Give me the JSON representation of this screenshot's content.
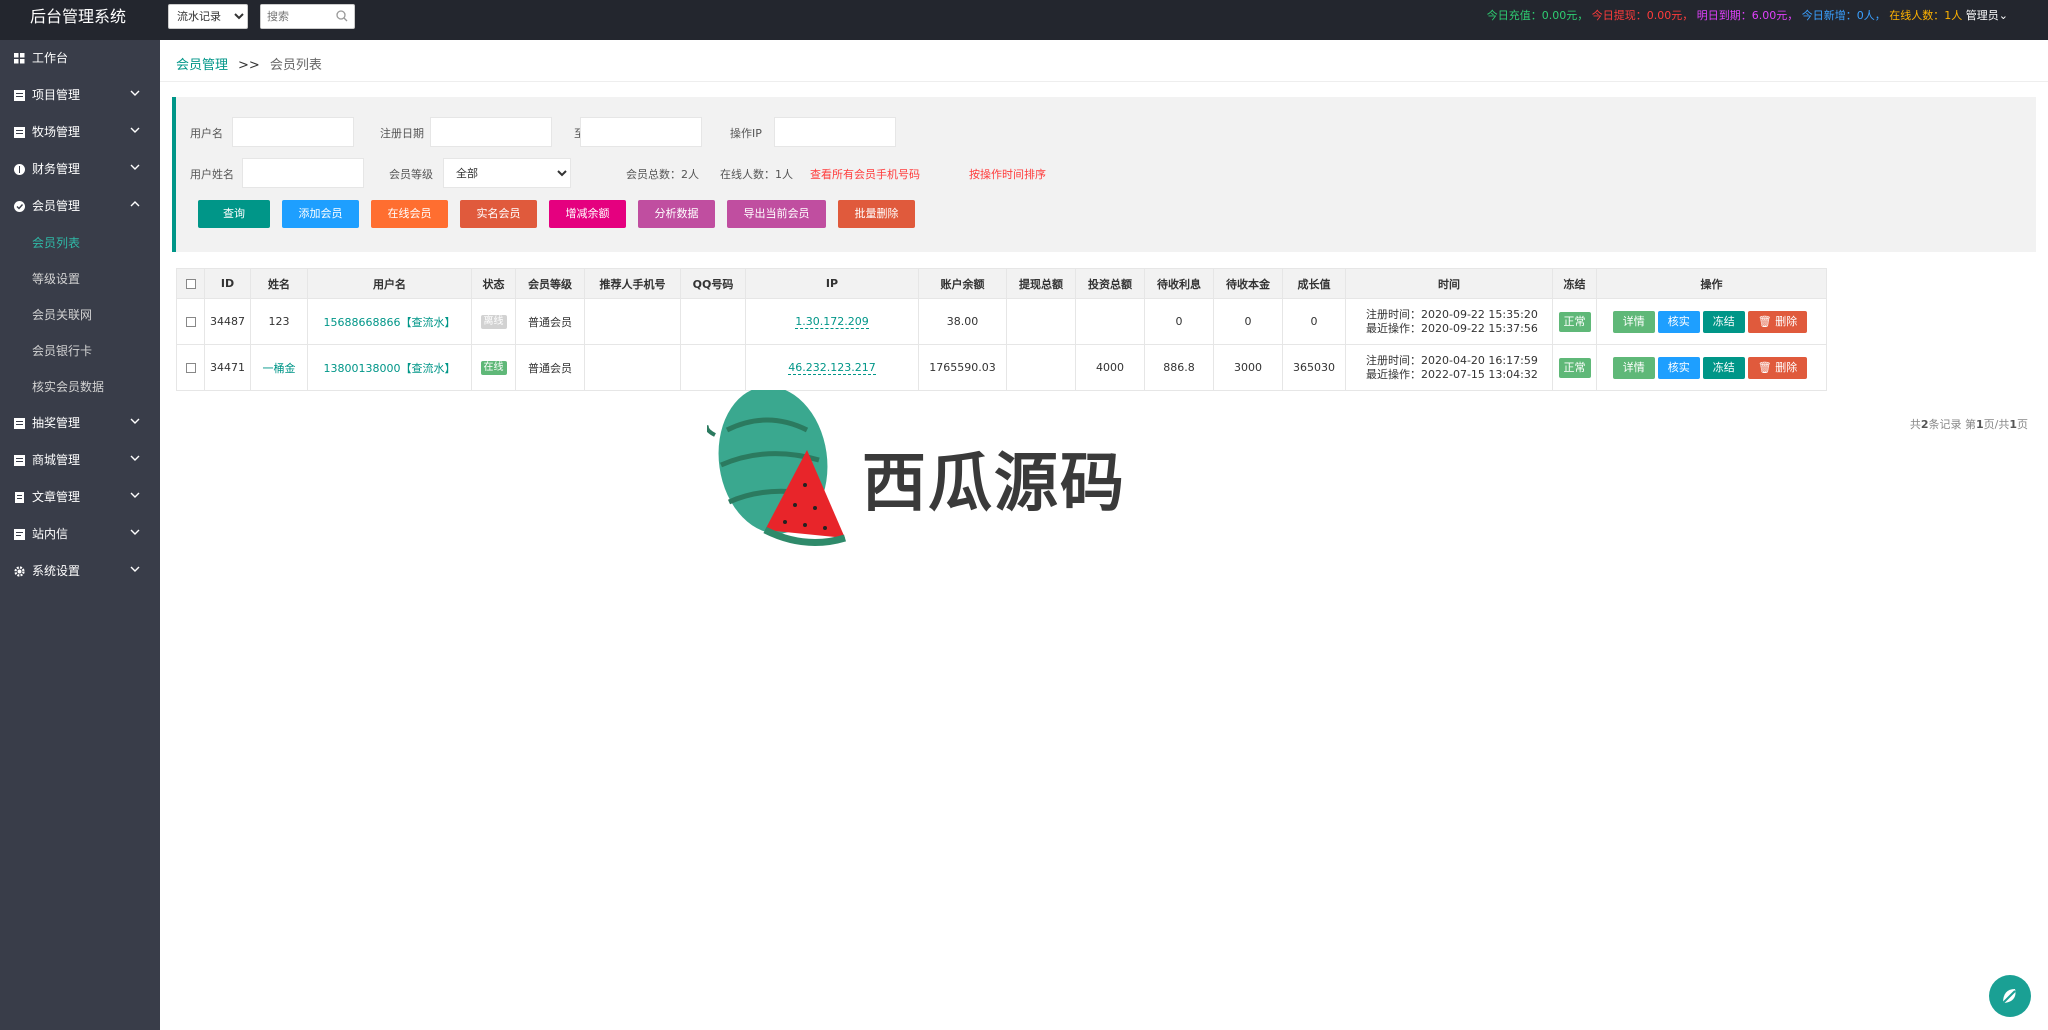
{
  "app": {
    "title": "后台管理系统"
  },
  "topbar": {
    "select_value": "流水记录",
    "search_placeholder": "搜索",
    "stats": {
      "today_recharge": "今日充值：0.00元，",
      "today_withdraw": "今日提现：0.00元，",
      "tomorrow_due": "明日到期：6.00元，",
      "today_new": "今日新增：0人，",
      "online": "在线人数：1人",
      "admin": "管理员"
    }
  },
  "sidebar": {
    "items": [
      {
        "label": "工作台"
      },
      {
        "label": "项目管理"
      },
      {
        "label": "牧场管理"
      },
      {
        "label": "财务管理"
      },
      {
        "label": "会员管理"
      }
    ],
    "sub_items": [
      "会员列表",
      "等级设置",
      "会员关联网",
      "会员银行卡",
      "核实会员数据"
    ],
    "items_after": [
      {
        "label": "抽奖管理"
      },
      {
        "label": "商城管理"
      },
      {
        "label": "文章管理"
      },
      {
        "label": "站内信"
      },
      {
        "label": "系统设置"
      }
    ]
  },
  "breadcrumb": {
    "parent": "会员管理",
    "sep": ">>",
    "current": "会员列表"
  },
  "filter": {
    "username_label": "用户名",
    "regdate_label": "注册日期",
    "to_label": "至",
    "ip_label": "操作IP",
    "realname_label": "用户姓名",
    "level_label": "会员等级",
    "level_value": "全部",
    "total_members": "会员总数：2人",
    "online_count": "在线人数：1人",
    "view_phones": "查看所有会员手机号码",
    "sort_link": "按操作时间排序"
  },
  "buttons": {
    "query": "查询",
    "add": "添加会员",
    "online": "在线会员",
    "realname": "实名会员",
    "balance": "增减余额",
    "analyze": "分析数据",
    "export": "导出当前会员",
    "batch_delete": "批量删除"
  },
  "table": {
    "headers": [
      "ID",
      "姓名",
      "用户名",
      "状态",
      "会员等级",
      "推荐人手机号",
      "QQ号码",
      "IP",
      "账户余额",
      "提现总额",
      "投资总额",
      "待收利息",
      "待收本金",
      "成长值",
      "时间",
      "冻结",
      "操作"
    ],
    "rows": [
      {
        "id": "34487",
        "name": "123",
        "username": "15688668866【查流水】",
        "status": "离线",
        "level": "普通会员",
        "referrer": "",
        "qq": "",
        "ip": "1.30.172.209",
        "balance": "38.00",
        "withdraw": "",
        "invest": "",
        "interest": "0",
        "principal": "0",
        "growth": "0",
        "reg_time": "注册时间：2020-09-22 15:35:20",
        "last_op": "最近操作：2020-09-22 15:37:56",
        "freeze": "正常"
      },
      {
        "id": "34471",
        "name": "一桶金",
        "username": "13800138000【查流水】",
        "status": "在线",
        "level": "普通会员",
        "referrer": "",
        "qq": "",
        "ip": "46.232.123.217",
        "balance": "1765590.03",
        "withdraw": "",
        "invest": "4000",
        "interest": "886.8",
        "principal": "3000",
        "growth": "365030",
        "reg_time": "注册时间：2020-04-20 16:17:59",
        "last_op": "最近操作：2022-07-15 13:04:32",
        "freeze": "正常"
      }
    ],
    "ops": {
      "detail": "详情",
      "verify": "核实",
      "freeze": "冻结",
      "delete": "删除"
    }
  },
  "pager": {
    "pre": "共",
    "count": "2",
    "mid": "条记录 第",
    "page": "1",
    "mid2": "页/共",
    "pages": "1",
    "post": "页"
  },
  "watermark": {
    "text": "西瓜源码"
  },
  "colors": {
    "accent": "#009688",
    "sidebar": "#393d49",
    "topbar": "#23262e"
  }
}
